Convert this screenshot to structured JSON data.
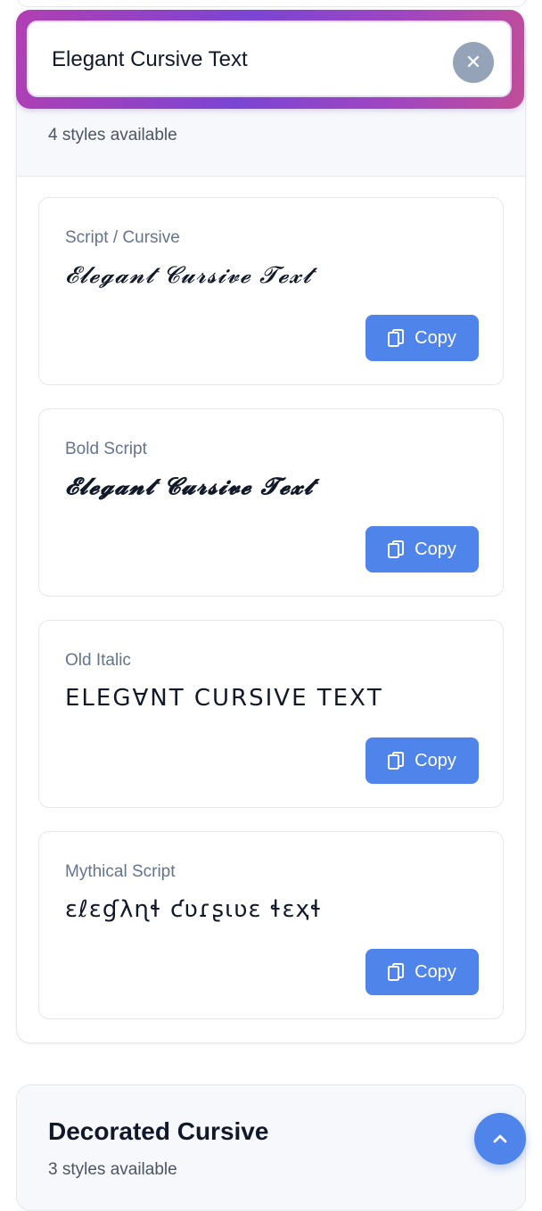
{
  "search": {
    "value": "Elegant Cursive Text",
    "placeholder": "",
    "clear_symbol": "✕"
  },
  "section": {
    "count_text": "4 styles available",
    "cards": [
      {
        "label": "Script / Cursive",
        "value": "𝓔𝓵𝓮𝓰𝓪𝓷𝓽 𝓒𝓾𝓻𝓼𝓲𝓿𝓮 𝓣𝓮𝔁𝓽",
        "copy_label": "Copy"
      },
      {
        "label": "Bold Script",
        "value": "𝓔𝓵𝓮𝓰𝓪𝓷𝓽 𝓒𝓾𝓻𝓼𝓲𝓿𝓮 𝓣𝓮𝔁𝓽",
        "copy_label": "Copy"
      },
      {
        "label": "Old Italic",
        "value": "ꓰꓡꓰꓖꓯꓠꓔ ꓚꓴꓣꓢꓲꓦꓰ ꓔꓰꓫꓔ",
        "copy_label": "Copy"
      },
      {
        "label": "Mythical Script",
        "value": "ɛℓɛɠλɳɬ ƈʋɾʂɩʋɛ ɬɛҳɬ",
        "copy_label": "Copy"
      }
    ]
  },
  "section2": {
    "title": "Decorated Cursive",
    "count_text": "3 styles available"
  },
  "colors": {
    "accent": "#4f84ea",
    "gradient_start": "#b13fb2",
    "gradient_mid": "#7b45d4",
    "gradient_end": "#c24d9a",
    "clear_button": "#94a3b8"
  },
  "icons": {
    "clear": "close-icon",
    "copy": "copy-icon",
    "scroll_top": "chevron-up-icon"
  }
}
